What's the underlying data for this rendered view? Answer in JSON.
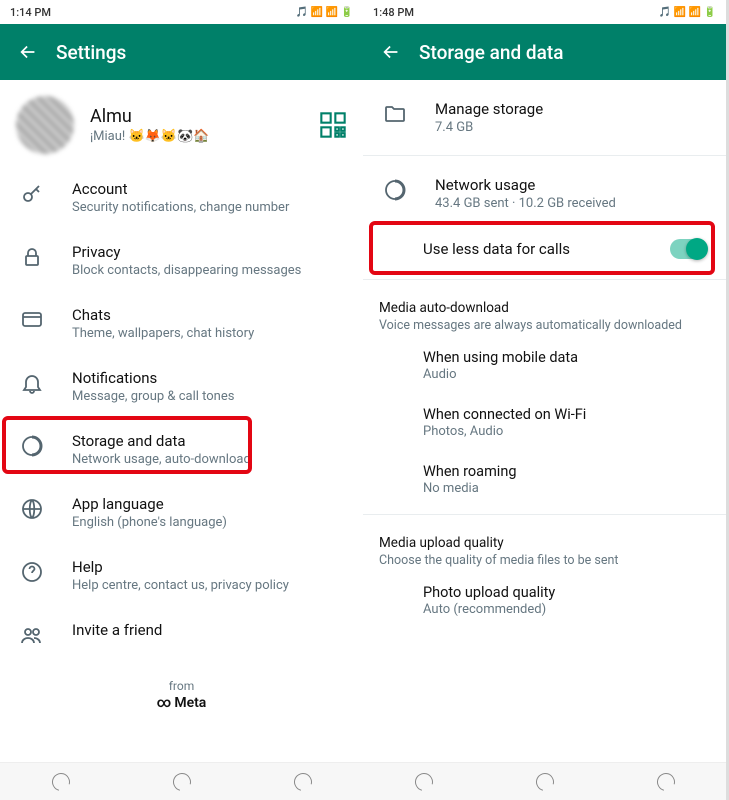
{
  "left": {
    "statusTime": "1:14 PM",
    "statusIcons": "🎵 📶 📶 🔋",
    "headerTitle": "Settings",
    "profile": {
      "name": "Almu",
      "status": "¡Miau! 🐱🦊🐱🐼🏠"
    },
    "items": {
      "account": {
        "title": "Account",
        "sub": "Security notifications, change number"
      },
      "privacy": {
        "title": "Privacy",
        "sub": "Block contacts, disappearing messages"
      },
      "chats": {
        "title": "Chats",
        "sub": "Theme, wallpapers, chat history"
      },
      "notifications": {
        "title": "Notifications",
        "sub": "Message, group & call tones"
      },
      "storage": {
        "title": "Storage and data",
        "sub": "Network usage, auto-download"
      },
      "language": {
        "title": "App language",
        "sub": "English (phone's language)"
      },
      "help": {
        "title": "Help",
        "sub": "Help centre, contact us, privacy policy"
      },
      "invite": {
        "title": "Invite a friend"
      }
    },
    "fromLabel": "from",
    "metaLabel": "Meta"
  },
  "right": {
    "statusTime": "1:48 PM",
    "statusIcons": "🎵 📶 📶 🔋",
    "headerTitle": "Storage and data",
    "manage": {
      "title": "Manage storage",
      "sub": "7.4 GB"
    },
    "network": {
      "title": "Network usage",
      "sub": "43.4 GB sent · 10.2 GB received"
    },
    "lessData": "Use less data for calls",
    "mediaAuto": {
      "title": "Media auto-download",
      "sub": "Voice messages are always automatically downloaded"
    },
    "mobile": {
      "title": "When using mobile data",
      "sub": "Audio"
    },
    "wifi": {
      "title": "When connected on Wi-Fi",
      "sub": "Photos, Audio"
    },
    "roaming": {
      "title": "When roaming",
      "sub": "No media"
    },
    "upload": {
      "title": "Media upload quality",
      "sub": "Choose the quality of media files to be sent"
    },
    "photo": {
      "title": "Photo upload quality",
      "sub": "Auto (recommended)"
    }
  }
}
